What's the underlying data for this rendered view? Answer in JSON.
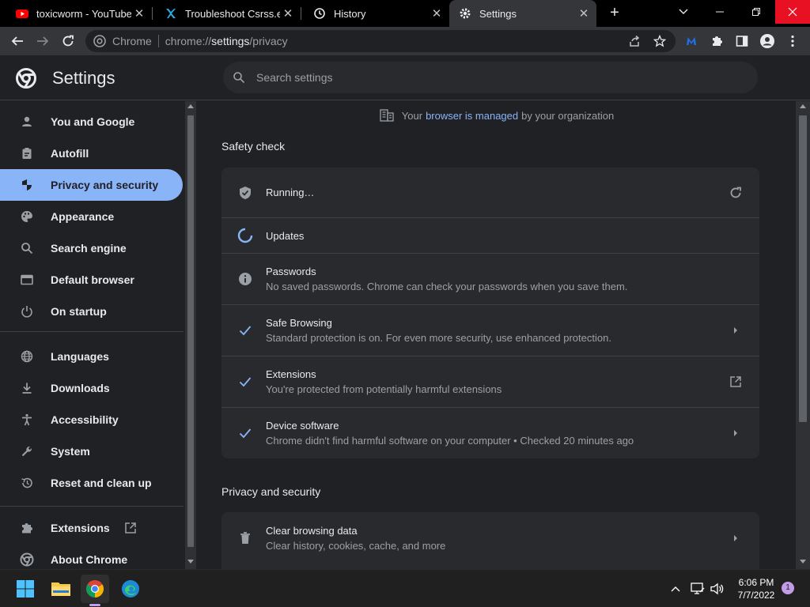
{
  "tabs": [
    {
      "title": "toxicworm - YouTube",
      "icon": "youtube-icon"
    },
    {
      "title": "Troubleshoot Csrss.exe",
      "icon": "site-x-icon"
    },
    {
      "title": "History",
      "icon": "history-icon"
    },
    {
      "title": "Settings",
      "icon": "gear-icon",
      "active": true
    }
  ],
  "omnibox": {
    "scheme_label": "Chrome",
    "url_prefix": "chrome://",
    "url_host": "settings",
    "url_path": "/privacy"
  },
  "header": {
    "title": "Settings",
    "search_placeholder": "Search settings"
  },
  "sidebar": {
    "items": [
      {
        "label": "You and Google",
        "icon": "person-icon"
      },
      {
        "label": "Autofill",
        "icon": "clipboard-icon"
      },
      {
        "label": "Privacy and security",
        "icon": "shield-icon",
        "selected": true
      },
      {
        "label": "Appearance",
        "icon": "palette-icon"
      },
      {
        "label": "Search engine",
        "icon": "search-icon"
      },
      {
        "label": "Default browser",
        "icon": "browser-icon"
      },
      {
        "label": "On startup",
        "icon": "power-icon"
      },
      {
        "label": "Languages",
        "icon": "globe-icon"
      },
      {
        "label": "Downloads",
        "icon": "download-icon"
      },
      {
        "label": "Accessibility",
        "icon": "accessibility-icon"
      },
      {
        "label": "System",
        "icon": "wrench-icon"
      },
      {
        "label": "Reset and clean up",
        "icon": "reset-icon"
      },
      {
        "label": "Extensions",
        "icon": "puzzle-icon"
      },
      {
        "label": "About Chrome",
        "icon": "chrome-icon"
      }
    ]
  },
  "managed": {
    "prefix": "Your",
    "link": "browser is managed",
    "suffix": "by your organization"
  },
  "safety_check": {
    "title": "Safety check",
    "status": "Running…",
    "rows": [
      {
        "title": "Updates",
        "subtitle": ""
      },
      {
        "title": "Passwords",
        "subtitle": "No saved passwords. Chrome can check your passwords when you save them."
      },
      {
        "title": "Safe Browsing",
        "subtitle": "Standard protection is on. For even more security, use enhanced protection."
      },
      {
        "title": "Extensions",
        "subtitle": "You're protected from potentially harmful extensions"
      },
      {
        "title": "Device software",
        "subtitle": "Chrome didn't find harmful software on your computer • Checked 20 minutes ago"
      }
    ]
  },
  "privacy": {
    "title": "Privacy and security",
    "rows": [
      {
        "title": "Clear browsing data",
        "subtitle": "Clear history, cookies, cache, and more"
      }
    ]
  },
  "taskbar": {
    "time": "6:06 PM",
    "date": "7/7/2022",
    "notification_count": "1"
  },
  "colors": {
    "accent": "#8ab4f8",
    "close_red": "#e81123",
    "badge": "#c39ce8"
  }
}
